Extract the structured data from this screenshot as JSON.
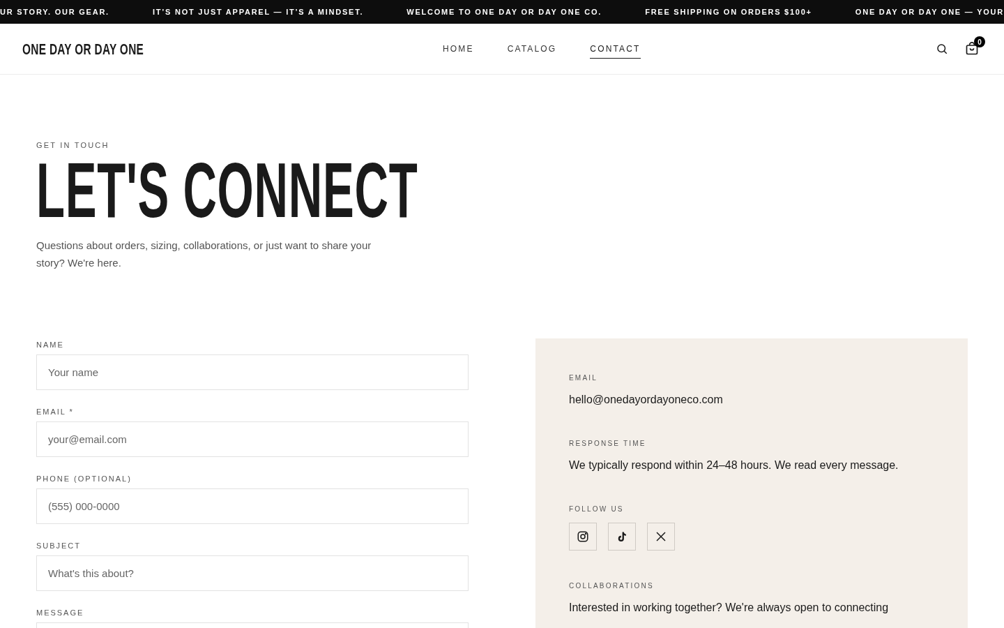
{
  "announcements": [
    "UR STORY. OUR GEAR.",
    "IT’S NOT JUST APPAREL — IT’S A MINDSET.",
    "WELCOME TO ONE DAY OR DAY ONE CO.",
    "FREE SHIPPING ON ORDERS $100+",
    "ONE DAY OR DAY ONE — YOUR"
  ],
  "header": {
    "logo": "ONE DAY OR DAY ONE",
    "nav": [
      {
        "label": "HOME",
        "selected": false
      },
      {
        "label": "CATALOG",
        "selected": false
      },
      {
        "label": "CONTACT",
        "selected": true
      }
    ],
    "cart_count": "0"
  },
  "hero": {
    "eyebrow": "GET IN TOUCH",
    "title": "LET'S CONNECT",
    "intro": "Questions about orders, sizing, collaborations, or just want to share your story? We're here."
  },
  "form": {
    "fields": [
      {
        "label": "NAME",
        "kind": "input",
        "placeholder": "Your name"
      },
      {
        "label": "EMAIL *",
        "kind": "input",
        "placeholder": "your@email.com"
      },
      {
        "label": "PHONE (OPTIONAL)",
        "kind": "input",
        "placeholder": "(555) 000-0000"
      },
      {
        "label": "SUBJECT",
        "kind": "input",
        "placeholder": "What's this about?"
      },
      {
        "label": "MESSAGE",
        "kind": "textarea"
      }
    ]
  },
  "info": {
    "sections": [
      {
        "kind": "text",
        "label": "EMAIL",
        "text": "hello@onedayordayoneco.com"
      },
      {
        "kind": "text",
        "label": "RESPONSE TIME",
        "text": "We typically respond within 24–48 hours. We read every message."
      },
      {
        "kind": "social",
        "label": "FOLLOW US",
        "links": [
          {
            "kind": "instagram"
          },
          {
            "kind": "tiktok"
          },
          {
            "kind": "x"
          }
        ]
      },
      {
        "kind": "text",
        "label": "COLLABORATIONS",
        "text": "Interested in working together? We're always open to connecting"
      }
    ]
  }
}
